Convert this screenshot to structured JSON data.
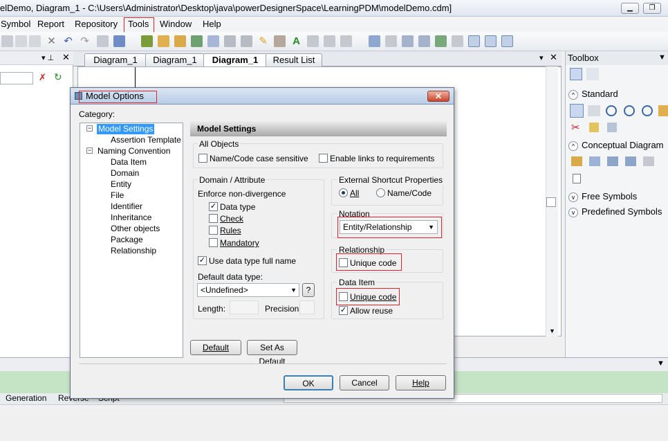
{
  "window": {
    "title": "elDemo, Diagram_1 - C:\\Users\\Administrator\\Desktop\\java\\powerDesignerSpace\\LearningPDM\\modelDemo.cdm]"
  },
  "menu": {
    "items": [
      "Symbol",
      "Report",
      "Repository",
      "Tools",
      "Window",
      "Help"
    ]
  },
  "tabs": {
    "items": [
      "Diagram_1",
      "Diagram_1",
      "Diagram_1",
      "Result List"
    ]
  },
  "toolbox": {
    "title": "Toolbox",
    "sections": [
      "Standard",
      "Conceptual Diagram",
      "Free Symbols",
      "Predefined Symbols"
    ]
  },
  "bottom_tabs": {
    "items": [
      "Generation",
      "Reverse",
      "Script"
    ]
  },
  "dialog": {
    "title": "Model Options",
    "category_label": "Category:",
    "tree": [
      {
        "label": "Model Settings",
        "level": 1,
        "expanded": true,
        "selected": true
      },
      {
        "label": "Assertion Template",
        "level": 2
      },
      {
        "label": "Naming Convention",
        "level": 1,
        "expanded": true
      },
      {
        "label": "Data Item",
        "level": 2
      },
      {
        "label": "Domain",
        "level": 2
      },
      {
        "label": "Entity",
        "level": 2
      },
      {
        "label": "File",
        "level": 2
      },
      {
        "label": "Identifier",
        "level": 2
      },
      {
        "label": "Inheritance",
        "level": 2
      },
      {
        "label": "Other objects",
        "level": 2
      },
      {
        "label": "Package",
        "level": 2
      },
      {
        "label": "Relationship",
        "level": 2
      }
    ],
    "section_title": "Model Settings",
    "all_objects": {
      "label": "All Objects",
      "case_sensitive": {
        "label": "Name/Code case sensitive",
        "checked": false
      },
      "links_requirements": {
        "label": "Enable links to requirements",
        "checked": false
      }
    },
    "domain": {
      "label": "Domain / Attribute",
      "enforce_label": "Enforce non-divergence",
      "data_type": {
        "label": "Data type",
        "checked": true
      },
      "check": {
        "label": "Check",
        "checked": false
      },
      "rules": {
        "label": "Rules",
        "checked": false
      },
      "mandatory": {
        "label": "Mandatory",
        "checked": false
      },
      "full_name": {
        "label": "Use data type full name",
        "checked": true
      },
      "default_type_label": "Default data type:",
      "default_type_value": "<Undefined>",
      "help_button": "?",
      "length_label": "Length:",
      "precision_label": "Precision:"
    },
    "shortcut": {
      "label": "External Shortcut Properties",
      "all": {
        "label": "All",
        "selected": true
      },
      "name_code": {
        "label": "Name/Code",
        "selected": false
      }
    },
    "notation": {
      "label": "Notation",
      "value": "Entity/Relationship"
    },
    "relationship": {
      "label": "Relationship",
      "unique_code": {
        "label": "Unique code",
        "checked": false
      }
    },
    "data_item": {
      "label": "Data Item",
      "unique_code": {
        "label": "Unique code",
        "checked": false
      },
      "allow_reuse": {
        "label": "Allow reuse",
        "checked": true
      }
    },
    "buttons": {
      "default": "Default",
      "set_default": "Set As Default",
      "ok": "OK",
      "cancel": "Cancel",
      "help": "Help"
    }
  }
}
